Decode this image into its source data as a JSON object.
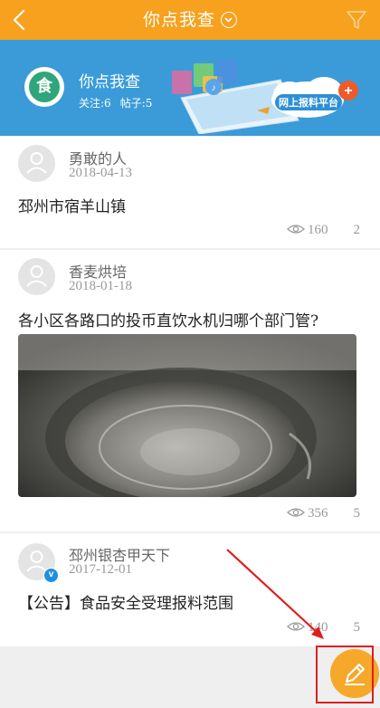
{
  "header": {
    "title": "你点我查",
    "back_icon": "back-chevron-icon",
    "filter_icon": "filter-icon",
    "bg_color": "#f7a11e"
  },
  "banner": {
    "name": "你点我查",
    "followers": "关注:6",
    "posts": "帖子:5",
    "logo_char": "食",
    "platform_label": "网上报料平台",
    "bg_color": "#3b9bd9"
  },
  "posts": [
    {
      "author": "勇敢的人",
      "date": "2018-04-13",
      "title": "邳州市宿羊山镇",
      "views": "160",
      "comments": "2",
      "verified": false
    },
    {
      "author": "香麦烘培",
      "date": "2018-01-18",
      "title": "各小区各路口的投币直饮水机归哪个部门管?",
      "views": "356",
      "comments": "5",
      "has_photo": true,
      "verified": false
    },
    {
      "author": "邳州银杏甲天下",
      "date": "2017-12-01",
      "title": "【公告】食品安全受理报料范围",
      "views": "140",
      "comments": "5",
      "verified": true
    }
  ],
  "fab": {
    "icon": "edit-pencil-icon",
    "color": "#f6a82a"
  },
  "annotation": {
    "color": "#e01e1e"
  }
}
